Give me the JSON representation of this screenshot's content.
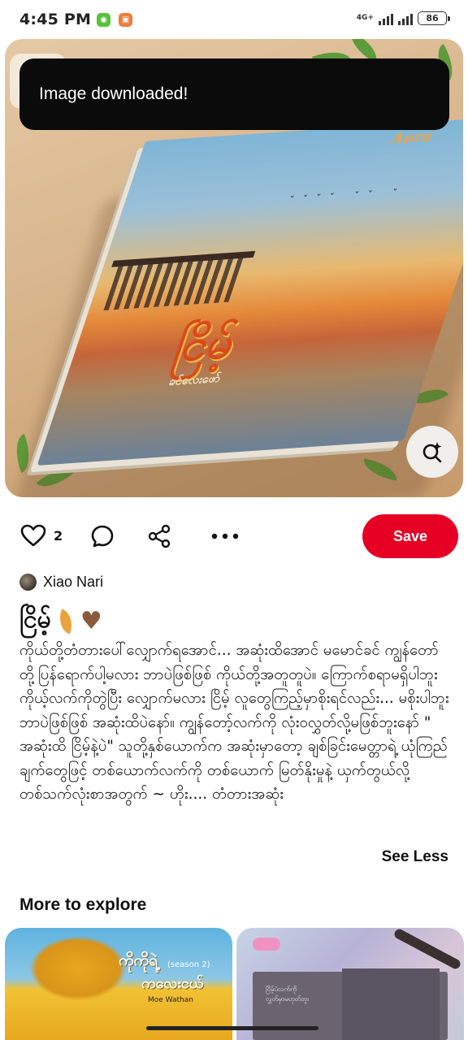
{
  "status_bar": {
    "time": "4:45 PM",
    "network": "4G+",
    "battery": "86"
  },
  "toast": {
    "message": "Image downloaded!"
  },
  "hero": {
    "cover_brand": "Aura",
    "cover_title": "ငြိမ့်",
    "cover_author": "ခင်လေးဖော်"
  },
  "actions": {
    "like_count": "2",
    "save_label": "Save"
  },
  "author": {
    "name": "Xiao Nari"
  },
  "pin": {
    "title": "ငြိမ့်",
    "description": "ကိုယ်တို့တံတားပေါ်လျှောက်ရအောင်... အဆုံးထိအောင် မမောင်ခင် ကျွန်တော်တို့ပြန်ရောက်ပါ့မလား ဘာပဲဖြစ်ဖြစ် ကိုယ်တို့အတူတူပဲ။ ကြောက်စရာမရှိပါဘူး ကိုယ့်လက်ကိုတွဲပြီး လျှောက်မလား ငြိမ့် လူတွေကြည့်မှာစိုးရင်လည်း... မစိုးပါဘူး ဘာပဲဖြစ်ဖြစ် အဆုံးထိပဲနော်။ ကျွန်တော့်လက်ကို လုံးဝလွှတ်လို့မဖြစ်ဘူးနော် \" အဆုံးထိ ငြိမ့်နဲ့ပဲ\" သူတို့နှစ်ယောက်က အဆုံးမှာတော့ ချစ်ခြင်းမေတ္တာရဲ့ ယုံကြည်ချက်တွေဖြင့် တစ်ယောက်လက်ကို တစ်ယောက် မြတ်နိုးမှုနဲ့ ယှက်တွယ်လို့ တစ်သက်လုံးစာအတွက် ~ ဟိုး.... တံတားအဆုံး",
    "see_less": "See Less"
  },
  "more": {
    "heading": "More to explore",
    "cards": [
      {
        "title": "ကိုကိုရဲ့",
        "season": "(season 2)",
        "subtitle": "ကလေးငယ်",
        "author": "Moe Wathan"
      },
      {
        "line1": "ငြိမ့်ပဲလက်ကို",
        "line2": "လွှတ်မှာမဟုတ်ဘူး"
      }
    ]
  },
  "colors": {
    "save_red": "#e60023",
    "toast_bg": "#0b0b0b"
  }
}
